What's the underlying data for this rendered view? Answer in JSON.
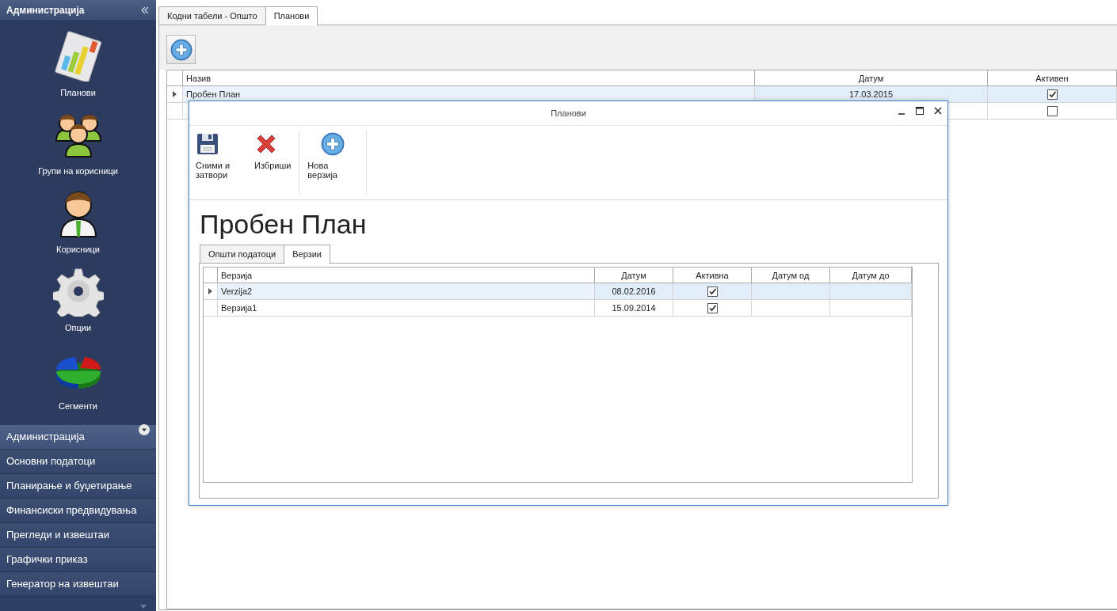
{
  "sidebar": {
    "title": "Администрација",
    "items": [
      {
        "label": "Планови"
      },
      {
        "label": "Групи на корисници"
      },
      {
        "label": "Корисници"
      },
      {
        "label": "Опции"
      },
      {
        "label": "Сегменти"
      }
    ],
    "sections": [
      {
        "label": "Администрација",
        "selected": true
      },
      {
        "label": "Основни податоци",
        "selected": false
      },
      {
        "label": "Планирање и буџетирање",
        "selected": false
      },
      {
        "label": "Финансиски предвидувања",
        "selected": false
      },
      {
        "label": "Прегледи и извештаи",
        "selected": false
      },
      {
        "label": "Графички приказ",
        "selected": false
      },
      {
        "label": "Генератор на извештаи",
        "selected": false
      }
    ]
  },
  "tabs": [
    {
      "label": "Кодни табели - Општо",
      "selected": false
    },
    {
      "label": "Планови",
      "selected": true
    }
  ],
  "grid": {
    "columns": [
      {
        "label": "Назив",
        "kind": "text"
      },
      {
        "label": "Датум",
        "kind": "date"
      },
      {
        "label": "Активен",
        "kind": "check"
      }
    ],
    "rows": [
      {
        "selected": true,
        "cells": [
          "Пробен План",
          "17.03.2015",
          true
        ]
      },
      {
        "selected": false,
        "cells": [
          null,
          null,
          false
        ]
      }
    ]
  },
  "dialog": {
    "title": "Планови",
    "toolbar": [
      {
        "label": "Сними и затвори",
        "kind": "save"
      },
      {
        "label": "Избриши",
        "kind": "delete"
      },
      {
        "label": "Нова верзија",
        "kind": "add"
      }
    ],
    "heading": "Пробен План",
    "tabs": [
      {
        "label": "Општи податоци",
        "selected": false
      },
      {
        "label": "Верзии",
        "selected": true
      }
    ],
    "grid": {
      "columns": [
        {
          "label": "Верзија",
          "kind": "text"
        },
        {
          "label": "Датум",
          "kind": "date"
        },
        {
          "label": "Активна",
          "kind": "check"
        },
        {
          "label": "Датум од",
          "kind": "date"
        },
        {
          "label": "Датум до",
          "kind": "date"
        }
      ],
      "rows": [
        {
          "selected": true,
          "cells": [
            "Verzija2",
            "08.02.2016",
            true,
            null,
            null
          ]
        },
        {
          "selected": false,
          "cells": [
            "Верзија1",
            "15.09.2014",
            true,
            null,
            null
          ]
        }
      ]
    }
  }
}
